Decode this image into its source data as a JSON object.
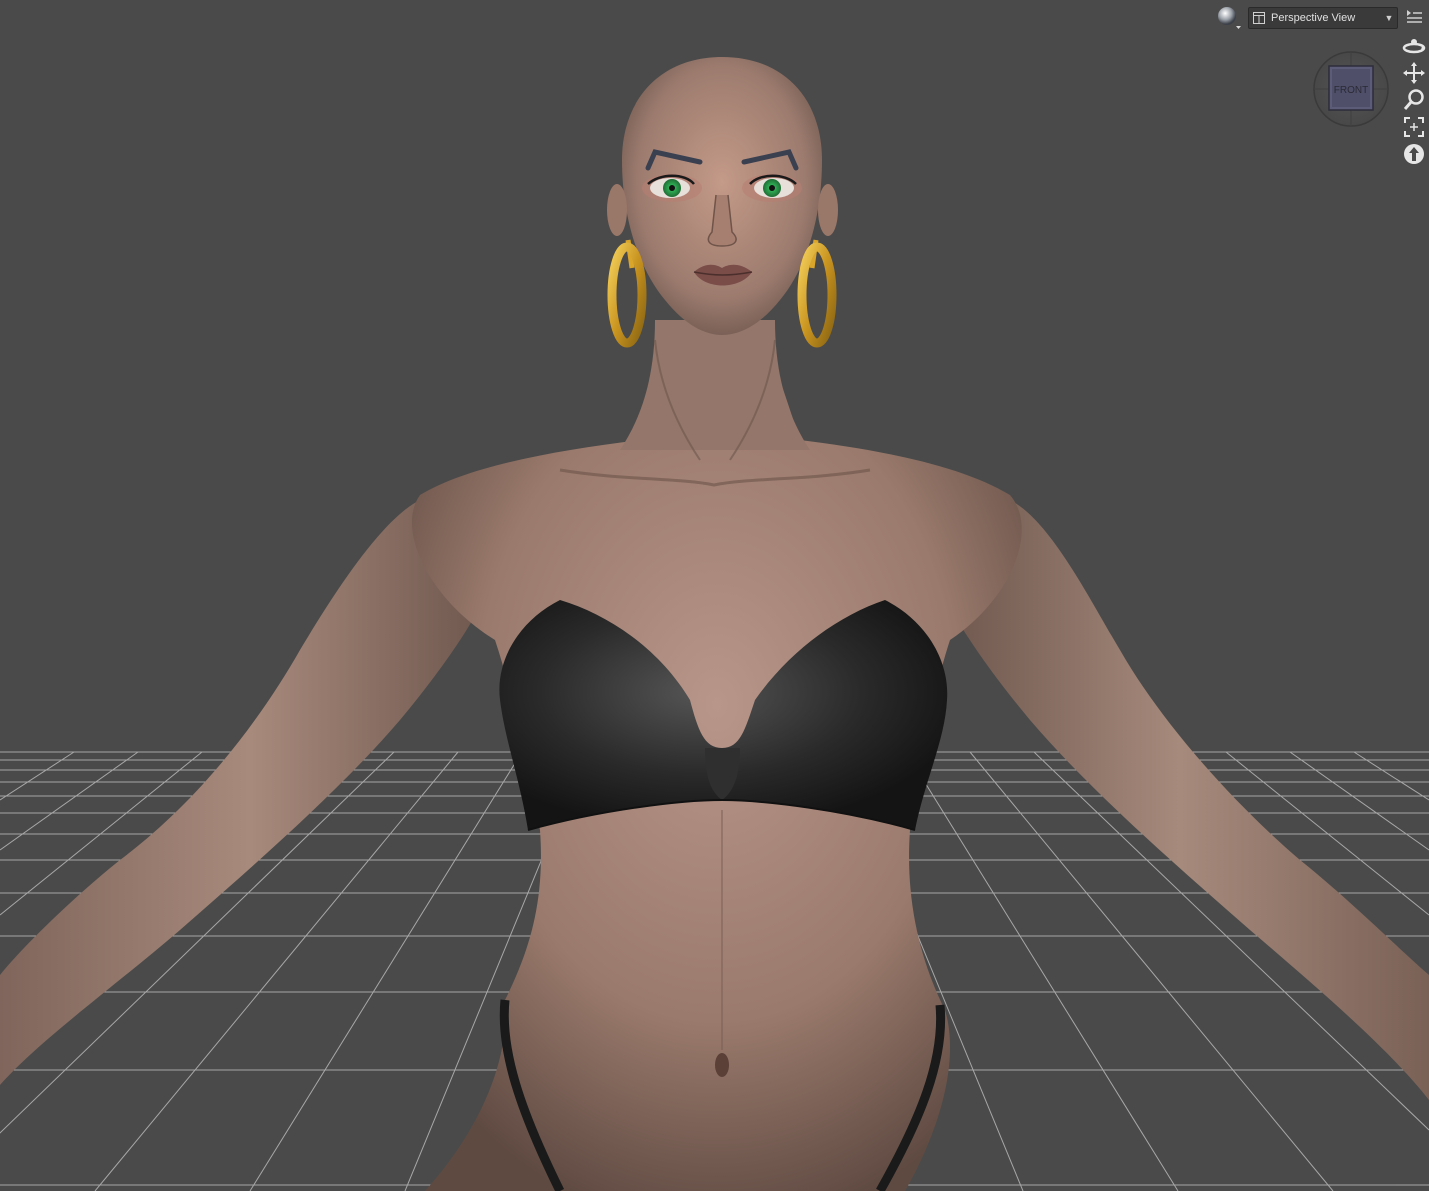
{
  "viewport": {
    "background_color": "#4a4a4a",
    "grid_color": "#b8b8b8"
  },
  "toolbar": {
    "shading_icon": "sphere-shading-icon",
    "view_mode_icon": "single-layout-icon",
    "view_mode_label": "Perspective View",
    "dropdown_icon": "chevron-down-icon",
    "menu_icon": "options-menu-icon"
  },
  "navigation_tools": [
    {
      "name": "orbit-icon"
    },
    {
      "name": "pan-icon"
    },
    {
      "name": "zoom-icon"
    },
    {
      "name": "frame-icon"
    },
    {
      "name": "reset-view-icon"
    }
  ],
  "view_cube": {
    "icon": "view-cube-icon",
    "face_label": "FRONT"
  },
  "scene": {
    "figure_description_colors": {
      "skin": "#a08070",
      "clothing": "#222222",
      "earrings": "#d9a52b",
      "eyes": "#2fae55",
      "eyebrows": "#3a4050"
    }
  }
}
